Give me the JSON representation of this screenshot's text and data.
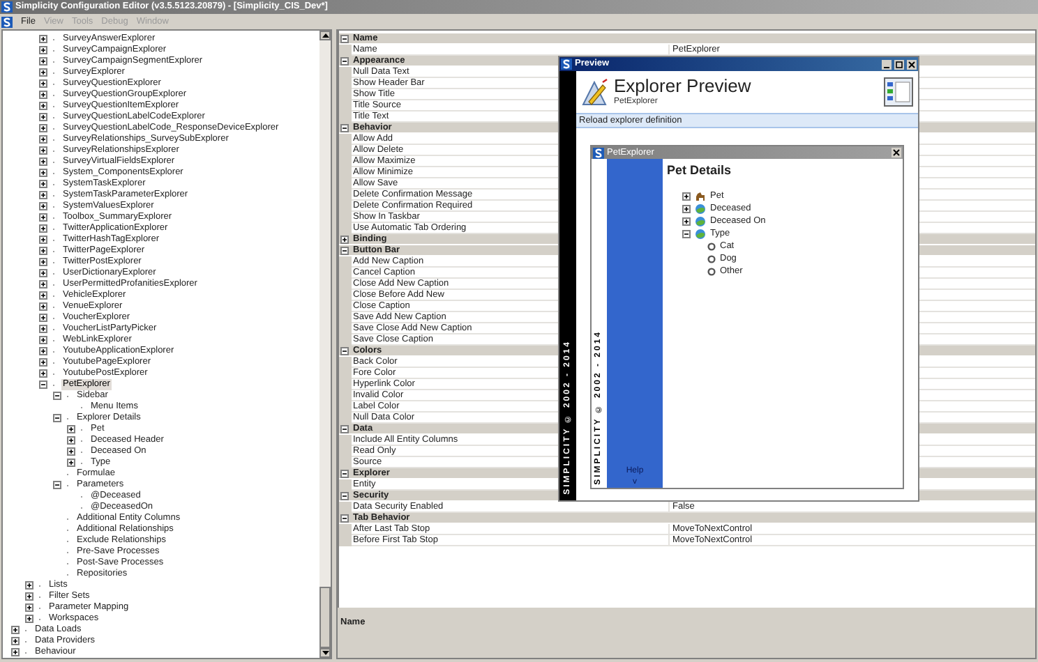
{
  "window": {
    "title": "Simplicity Configuration Editor (v3.5.5123.20879) - [Simplicity_CIS_Dev*]"
  },
  "menu": [
    {
      "label": "File",
      "disabled": false
    },
    {
      "label": "View",
      "disabled": true
    },
    {
      "label": "Tools",
      "disabled": true
    },
    {
      "label": "Debug",
      "disabled": true
    },
    {
      "label": "Window",
      "disabled": true
    }
  ],
  "tree": [
    {
      "children": [
        {
          "children": [
            {
              "label": "SurveyAnswerExplorer",
              "expanded": false,
              "selected": false
            },
            {
              "label": "SurveyCampaignExplorer",
              "expanded": false,
              "selected": false
            },
            {
              "label": "SurveyCampaignSegmentExplorer",
              "expanded": false,
              "selected": false
            },
            {
              "label": "SurveyExplorer",
              "expanded": false,
              "selected": false
            },
            {
              "label": "SurveyQuestionExplorer",
              "expanded": false,
              "selected": false
            },
            {
              "label": "SurveyQuestionGroupExplorer",
              "expanded": false,
              "selected": false
            },
            {
              "label": "SurveyQuestionItemExplorer",
              "expanded": false,
              "selected": false
            },
            {
              "label": "SurveyQuestionLabelCodeExplorer",
              "expanded": false,
              "selected": false
            },
            {
              "label": "SurveyQuestionLabelCode_ResponseDeviceExplorer",
              "expanded": false,
              "selected": false
            },
            {
              "label": "SurveyRelationships_SurveySubExplorer",
              "expanded": false,
              "selected": false
            },
            {
              "label": "SurveyRelationshipsExplorer",
              "expanded": false,
              "selected": false
            },
            {
              "label": "SurveyVirtualFieldsExplorer",
              "expanded": false,
              "selected": false
            },
            {
              "label": "System_ComponentsExplorer",
              "expanded": false,
              "selected": false
            },
            {
              "label": "SystemTaskExplorer",
              "expanded": false,
              "selected": false
            },
            {
              "label": "SystemTaskParameterExplorer",
              "expanded": false,
              "selected": false
            },
            {
              "label": "SystemValuesExplorer",
              "expanded": false,
              "selected": false
            },
            {
              "label": "Toolbox_SummaryExplorer",
              "expanded": false,
              "selected": false
            },
            {
              "label": "TwitterApplicationExplorer",
              "expanded": false,
              "selected": false
            },
            {
              "label": "TwitterHashTagExplorer",
              "expanded": false,
              "selected": false
            },
            {
              "label": "TwitterPageExplorer",
              "expanded": false,
              "selected": false
            },
            {
              "label": "TwitterPostExplorer",
              "expanded": false,
              "selected": false
            },
            {
              "label": "UserDictionaryExplorer",
              "expanded": false,
              "selected": false
            },
            {
              "label": "UserPermittedProfanitiesExplorer",
              "expanded": false,
              "selected": false
            },
            {
              "label": "VehicleExplorer",
              "expanded": false,
              "selected": false
            },
            {
              "label": "VenueExplorer",
              "expanded": false,
              "selected": false
            },
            {
              "label": "VoucherExplorer",
              "expanded": false,
              "selected": false
            },
            {
              "label": "VoucherListPartyPicker",
              "expanded": false,
              "selected": false
            },
            {
              "label": "WebLinkExplorer",
              "expanded": false,
              "selected": false
            },
            {
              "label": "YoutubeApplicationExplorer",
              "expanded": false,
              "selected": false
            },
            {
              "label": "YoutubePageExplorer",
              "expanded": false,
              "selected": false
            },
            {
              "label": "YoutubePostExplorer",
              "expanded": false,
              "selected": false
            },
            {
              "label": "PetExplorer",
              "expanded": true,
              "selected": true,
              "children": [
                {
                  "label": "Sidebar",
                  "expanded": true,
                  "selected": false,
                  "children": [
                    {
                      "label": "Menu Items",
                      "selected": false
                    }
                  ]
                },
                {
                  "label": "Explorer Details",
                  "expanded": true,
                  "selected": false,
                  "children": [
                    {
                      "label": "Pet",
                      "expanded": false,
                      "selected": false
                    },
                    {
                      "label": "Deceased Header",
                      "expanded": false,
                      "selected": false
                    },
                    {
                      "label": "Deceased On",
                      "expanded": false,
                      "selected": false
                    },
                    {
                      "label": "Type",
                      "expanded": false,
                      "selected": false
                    }
                  ]
                },
                {
                  "label": "Formulae",
                  "selected": false
                },
                {
                  "label": "Parameters",
                  "expanded": true,
                  "selected": false,
                  "children": [
                    {
                      "label": "@Deceased",
                      "selected": false
                    },
                    {
                      "label": "@DeceasedOn",
                      "selected": false
                    }
                  ]
                },
                {
                  "label": "Additional Entity Columns",
                  "selected": false
                },
                {
                  "label": "Additional Relationships",
                  "selected": false
                },
                {
                  "label": "Exclude Relationships",
                  "selected": false
                },
                {
                  "label": "Pre-Save Processes",
                  "selected": false
                },
                {
                  "label": "Post-Save Processes",
                  "selected": false
                },
                {
                  "label": "Repositories",
                  "selected": false
                }
              ]
            }
          ]
        },
        {
          "label": "Lists",
          "expanded": false,
          "selected": false
        },
        {
          "label": "Filter Sets",
          "expanded": false,
          "selected": false
        },
        {
          "label": "Parameter Mapping",
          "expanded": false,
          "selected": false
        },
        {
          "label": "Workspaces",
          "expanded": false,
          "selected": false
        }
      ]
    },
    {
      "label": "Data Loads",
      "expanded": false,
      "selected": false
    },
    {
      "label": "Data Providers",
      "expanded": false,
      "selected": false
    },
    {
      "label": "Behaviour",
      "expanded": false,
      "selected": false
    }
  ],
  "properties": [
    {
      "category": "Name",
      "expanded": true,
      "rows": [
        {
          "name": "Name",
          "value": "PetExplorer"
        }
      ]
    },
    {
      "category": "Appearance",
      "expanded": true,
      "rows": [
        {
          "name": "Null Data Text"
        },
        {
          "name": "Show Header Bar"
        },
        {
          "name": "Show Title"
        },
        {
          "name": "Title Source"
        },
        {
          "name": "Title Text"
        }
      ]
    },
    {
      "category": "Behavior",
      "expanded": true,
      "rows": [
        {
          "name": "Allow Add"
        },
        {
          "name": "Allow Delete"
        },
        {
          "name": "Allow Maximize"
        },
        {
          "name": "Allow Minimize"
        },
        {
          "name": "Allow Save"
        },
        {
          "name": "Delete Confirmation Message"
        },
        {
          "name": "Delete Confirmation Required"
        },
        {
          "name": "Show In Taskbar"
        },
        {
          "name": "Use Automatic Tab Ordering"
        }
      ]
    },
    {
      "category": "Binding",
      "expanded": false
    },
    {
      "category": "Button Bar",
      "expanded": true,
      "rows": [
        {
          "name": "Add New Caption"
        },
        {
          "name": "Cancel Caption"
        },
        {
          "name": "Close Add New Caption"
        },
        {
          "name": "Close Before Add New"
        },
        {
          "name": "Close Caption"
        },
        {
          "name": "Save Add New Caption"
        },
        {
          "name": "Save Close Add New Caption"
        },
        {
          "name": "Save Close Caption"
        }
      ]
    },
    {
      "category": "Colors",
      "expanded": true,
      "rows": [
        {
          "name": "Back Color"
        },
        {
          "name": "Fore Color"
        },
        {
          "name": "Hyperlink Color"
        },
        {
          "name": "Invalid Color"
        },
        {
          "name": "Label Color"
        },
        {
          "name": "Null Data Color"
        }
      ]
    },
    {
      "category": "Data",
      "expanded": true,
      "rows": [
        {
          "name": "Include All Entity Columns"
        },
        {
          "name": "Read Only"
        },
        {
          "name": "Source"
        }
      ]
    },
    {
      "category": "Explorer",
      "expanded": true,
      "rows": [
        {
          "name": "Entity"
        }
      ]
    },
    {
      "category": "Security",
      "expanded": true,
      "rows": [
        {
          "name": "Data Security Enabled",
          "value": "False"
        }
      ]
    },
    {
      "category": "Tab Behavior",
      "expanded": true,
      "rows": [
        {
          "name": "After Last Tab Stop",
          "value": "MoveToNextControl"
        },
        {
          "name": "Before First Tab Stop",
          "value": "MoveToNextControl"
        }
      ]
    }
  ],
  "description": {
    "title": "Name"
  },
  "preview": {
    "title": "Preview",
    "brand_strip": "SIMPLICITY © 2002 - 2014",
    "heading": "Explorer Preview",
    "subheading": "PetExplorer",
    "reload": "Reload explorer definition",
    "inner": {
      "title": "PetExplorer",
      "brand_strip": "SIMPLICITY © 2002 - 2014",
      "help": "Help",
      "help_caret": "v",
      "heading": "Pet Details",
      "items": [
        {
          "label": "Pet",
          "kind": "entity",
          "expanded": false
        },
        {
          "label": "Deceased",
          "kind": "field",
          "expanded": false
        },
        {
          "label": "Deceased On",
          "kind": "field",
          "expanded": false
        },
        {
          "label": "Type",
          "kind": "field",
          "expanded": true,
          "children": [
            {
              "label": "Cat",
              "kind": "option"
            },
            {
              "label": "Dog",
              "kind": "option"
            },
            {
              "label": "Other",
              "kind": "option"
            }
          ]
        }
      ]
    }
  }
}
